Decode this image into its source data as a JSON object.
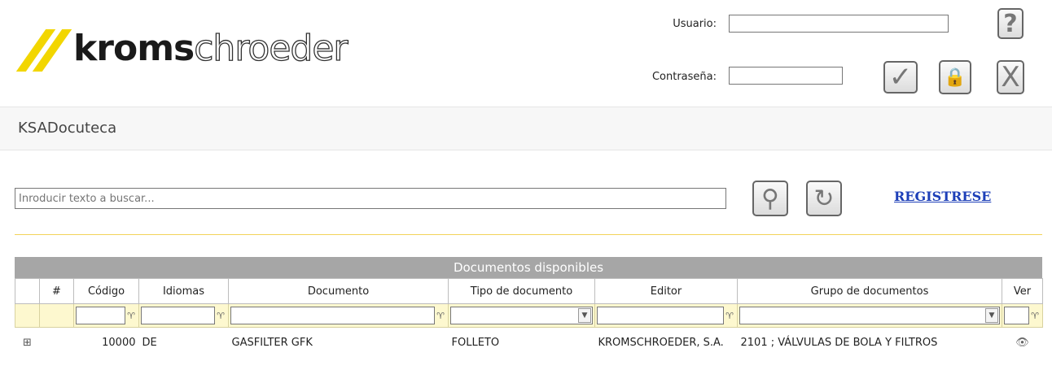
{
  "brand": {
    "bold": "kroms",
    "light": "chroeder"
  },
  "login": {
    "user_label": "Usuario:",
    "password_label": "Contraseña:",
    "user_value": "",
    "password_value": "",
    "help_glyph": "?",
    "accept_glyph": "✓",
    "lock_glyph": "🔒",
    "close_glyph": "X"
  },
  "page_title": "KSADocuteca",
  "search": {
    "placeholder": "Inroducir texto a buscar...",
    "value": "",
    "search_glyph": "⚲",
    "refresh_glyph": "↻"
  },
  "register_label": "REGISTRESE",
  "grid": {
    "title": "Documentos disponibles",
    "columns": [
      "",
      "#",
      "Código",
      "Idiomas",
      "Documento",
      "Tipo de documento",
      "Editor",
      "Grupo de documentos",
      "Ver"
    ],
    "filter_icon": "funnel-icon",
    "rows": [
      {
        "expand": "⊞",
        "num": "",
        "codigo": "10000",
        "idiomas": "DE",
        "documento": "GASFILTER GFK",
        "tipo": "FOLLETO",
        "editor": "KROMSCHROEDER, S.A.",
        "grupo": "2101 ; VÁLVULAS DE BOLA Y FILTROS",
        "ver": "👁"
      }
    ]
  },
  "colors": {
    "accent_yellow": "#f2d600",
    "link_blue": "#1d3fb8",
    "grid_header": "#a6a6a6",
    "filter_bg": "#fdf8cf"
  }
}
